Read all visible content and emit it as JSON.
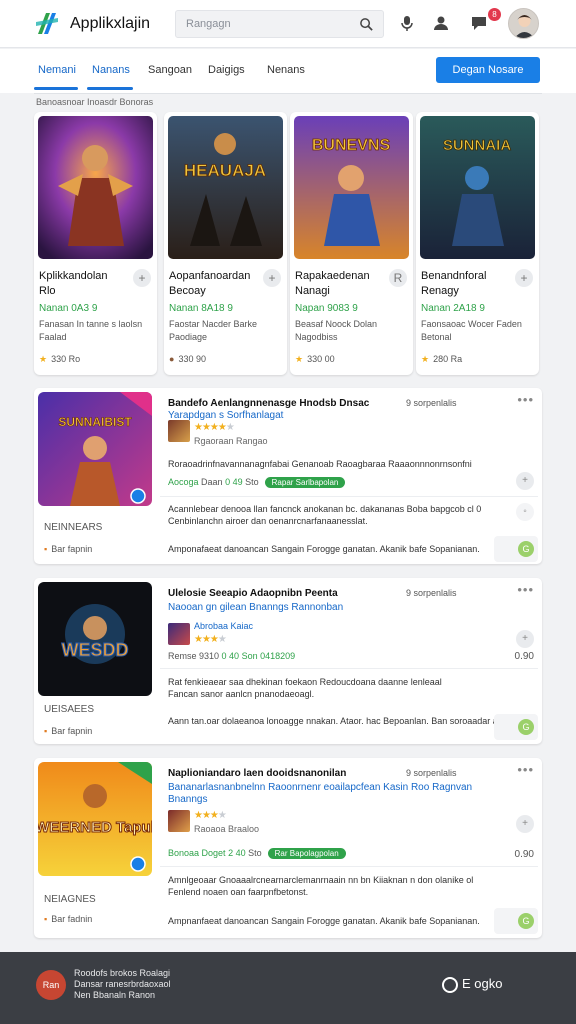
{
  "colors": {
    "accent": "#1a7fe6",
    "green": "#2fa24a",
    "star": "#f2b01e",
    "footer": "#3b3e44"
  },
  "header": {
    "brand": "Applikxlajin",
    "search_placeholder": "Rangagn",
    "icons": [
      "search-icon",
      "microphone-icon",
      "user-icon",
      "chat-icon"
    ],
    "notification_count": "8"
  },
  "tabs": [
    {
      "label": "Nemani",
      "active": true
    },
    {
      "label": "Nanans",
      "active": true
    },
    {
      "label": "Sangoan",
      "active": false
    },
    {
      "label": "Daigigs",
      "active": false
    },
    {
      "label": "Nenans",
      "active": false
    }
  ],
  "cta_label": "Degan Nosare",
  "breadcrumb": "Banoasnoar Inoasdr Bonoras",
  "featured": [
    {
      "art_text": "",
      "title": "Kplikkandolan Rlo",
      "price": "Nanan 0A3 9",
      "desc": "Fanasan In tanne s laolsn Faalad",
      "meta": "330 Ro",
      "icon": "star-icon",
      "plus": "+"
    },
    {
      "art_text": "HEAUAJA",
      "title": "Aopanfanoardan Becoay",
      "price": "Nanan 8A18 9",
      "desc": "Faostar Nacder Barke Paodiage",
      "meta": "330 90",
      "icon": "avatar-icon",
      "plus": "+"
    },
    {
      "art_text": "BUNEVNS",
      "title": "Rapakaedenan Nanagi",
      "price": "Napan 9083 9",
      "desc": "Beasaf Noock Dolan Nagodbiss",
      "meta": "330 00",
      "icon": "star-icon",
      "plus": "R"
    },
    {
      "art_text": "SUNNAIA",
      "title": "Benandnforal Renagy",
      "price": "Nanan 2A18 9",
      "desc": "Faonsaoac Wocer Faden Betonal",
      "meta": "280 Ra",
      "icon": "star-icon",
      "plus": "+"
    }
  ],
  "rows": [
    {
      "art_text": "SUNNAIBIST",
      "genre": "NEINNEARS",
      "footer_small": "Bar fapnin",
      "title": "Bandefo Aenlangnnenasge Hnodsb Dnsac",
      "title2": "Yarapdgan s Sorfhanlagat",
      "view": "9 sorpenlalis",
      "stars": "★★★★",
      "stars_empty": "★",
      "star_sub": "Rgaoraan Rangao",
      "meta_a": "Aocoga",
      "meta_b": "Daan",
      "meta_c": "0 49",
      "meta_d": "Sto",
      "pill": "Rapar Sarlbapolan",
      "body1": "Roraoadrinfnavannanagnfabai Genanoab Raoagbaraa Raaaonnnonrnsonfni",
      "body2": "Acannlebear denooa llan fancnck anokanan bc. dakananas Boba bapgcob cl 0",
      "body3": "Cenbinlanchn airoer dan oenanrcnarfanaanesslat.",
      "footer": "Amponafaeat danoancan Sangain Forogge ganatan. Akanik bafe Sopanianan.",
      "num": "",
      "right_icon": "+",
      "go_label": "G"
    },
    {
      "art_text": "WESDD",
      "genre": "UEISAEES",
      "footer_small": "Bar fapnin",
      "title": "Ulelosie Seeapio Adaopnibn Peenta",
      "title2": "Naooan gn gilean Bnanngs Rannonban",
      "view": "9 sorpenlalis",
      "stars": "★★★",
      "stars_empty": "★",
      "star_sub": "Abrobaa Kaiac",
      "meta_a": "Remse 9310",
      "meta_b": "",
      "meta_c": "0 40",
      "meta_d": "Son 0418209",
      "pill": "",
      "body1": "Rat fenkieaear saa dhekinan foekaon Redoucdoana daanne lenleaal",
      "body2": "Fancan sanor aanlcn pnanodaeoagl.",
      "body3": "",
      "footer": "Aann tan.oar dolaeanoa lonoagge nnakan. Ataor. hac Bepoanlan. Ban soroaadar anronaa.",
      "num": "0.90",
      "right_icon": "+",
      "go_label": "G"
    },
    {
      "art_text": "WEERNED Tapul",
      "genre": "NEIAGNES",
      "footer_small": "Bar fadnin",
      "title": "Naplioniandaro laen dooidsnanonilan",
      "title2": "Bananarlasnanbnelnn Raoonrnenr eoailapcfean Kasin Roo Ragnvan Bnanngs",
      "view": "9 sorpenlalis",
      "stars": "★★★",
      "stars_empty": "★",
      "star_sub": "Raoaoa Braaloo",
      "meta_a": "Bonoaa Doget",
      "meta_b": "",
      "meta_c": "2 40",
      "meta_d": "Sto",
      "pill": "Rar Bapolagpolan",
      "body1": "Amnlgeoaar Gnoaaalrcnearnarclemanrnaain nn bn Kiiaknan n don olanike ol",
      "body2": "Fenlend noaen oan faarpnfbetonst.",
      "body3": "",
      "footer": "Ampnanfaeat danoancan Sangain Forogge ganatan. Akanik bafe Sopanianan.",
      "num": "0.90",
      "right_icon": "+",
      "go_label": "G"
    }
  ],
  "footer": {
    "avatar": "Ran",
    "line1": "Roodofs brokos Roalagi",
    "line2": "Dansar ranesrbrdaoxaol",
    "line3": "Nen Bbanaln Ranon",
    "right": "E ogko"
  }
}
